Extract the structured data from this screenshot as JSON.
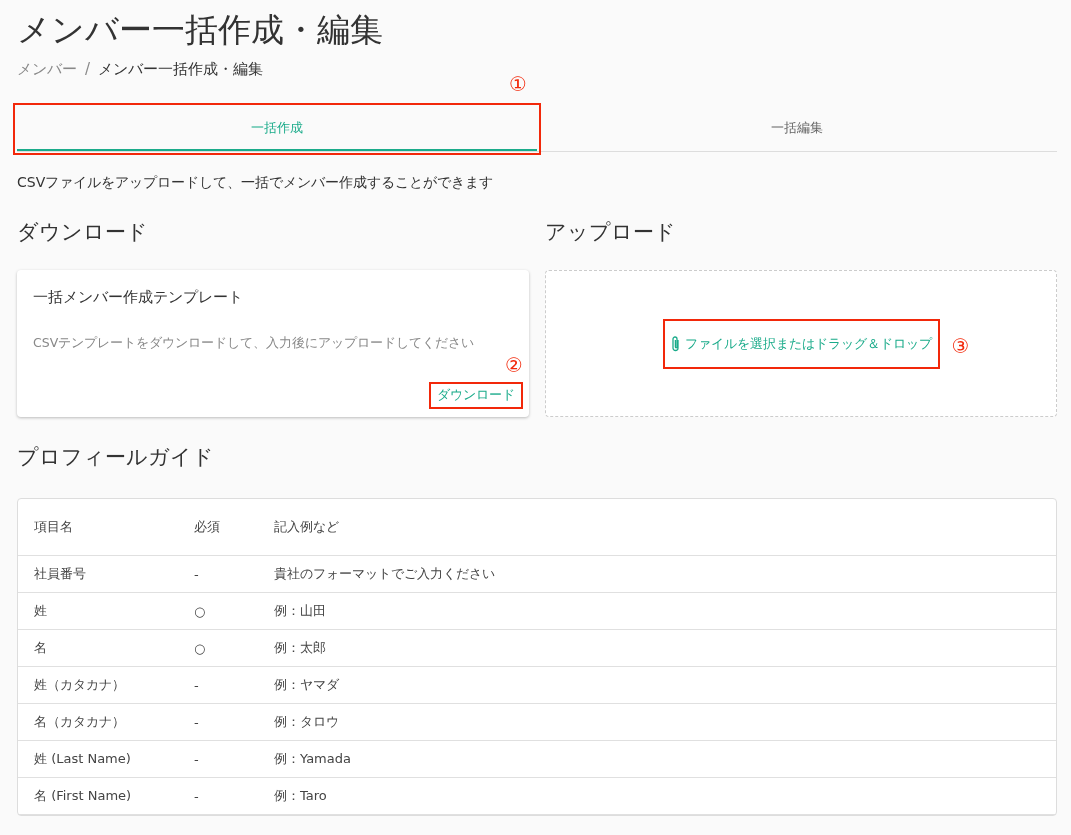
{
  "title": "メンバー一括作成・編集",
  "breadcrumbs": [
    "メンバー",
    "/",
    "メンバー一括作成・編集"
  ],
  "tabs": [
    {
      "label": "一括作成",
      "selected": true,
      "callout": "①"
    },
    {
      "label": "一括編集",
      "selected": false
    }
  ],
  "description": "CSVファイルをアップロードして、一括でメンバー作成することができます",
  "download": {
    "heading": "ダウンロード",
    "card_title": "一括メンバー作成テンプレート",
    "card_text": "CSVテンプレートをダウンロードして、入力後にアップロードしてください",
    "button": "ダウンロード",
    "callout": "②"
  },
  "upload": {
    "heading": "アップロード",
    "link": "ファイルを選択またはドラッグ＆ドロップ",
    "callout": "③"
  },
  "guide": {
    "heading": "プロフィールガイド",
    "columns": [
      "項目名",
      "必須",
      "記入例など"
    ],
    "rows": [
      [
        "社員番号",
        "-",
        "貴社のフォーマットでご入力ください"
      ],
      [
        "姓",
        "○",
        "例：山田"
      ],
      [
        "名",
        "○",
        "例：太郎"
      ],
      [
        "姓（カタカナ）",
        "-",
        "例：ヤマダ"
      ],
      [
        "名（カタカナ）",
        "-",
        "例：タロウ"
      ],
      [
        "姓 (Last Name)",
        "-",
        "例：Yamada"
      ],
      [
        "名 (First Name)",
        "-",
        "例：Taro"
      ]
    ]
  }
}
